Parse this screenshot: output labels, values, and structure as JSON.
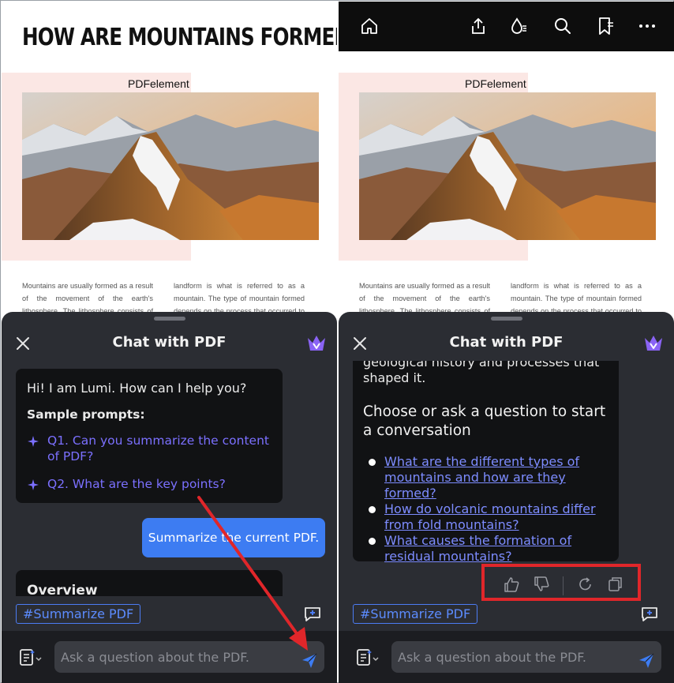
{
  "document": {
    "title": "HOW ARE MOUNTAINS FORMED?",
    "brand": "PDFelement",
    "col1_text": "Mountains are usually formed as a result of the movement of the earth's lithosphere. The lithosphere consists of the outer mantle",
    "col2_text": "landform is what is referred to as a mountain. The type of mountain formed depends on the process that occurred to form it."
  },
  "chat": {
    "title": "Chat with PDF",
    "greeting": "Hi! I am Lumi. How can I help you?",
    "sample_label": "Sample prompts:",
    "prompts": [
      "Q1. Can you summarize the content of PDF?",
      "Q2. What are the key points?"
    ],
    "user_message": "Summarize the current PDF.",
    "overview": "Overview",
    "answer_tail": "geological history and processes that shaped it.",
    "answer_heading": "Choose or ask a question to start a conversation",
    "suggestions": [
      "What are the different types of mountains and how are they formed?",
      "How do volcanic mountains differ from fold mountains?",
      "What causes the formation of residual mountains?"
    ],
    "tag": "#Summarize PDF",
    "input_placeholder": "Ask a question about the PDF."
  },
  "icons": {
    "toolbar": [
      "home-icon",
      "share-icon",
      "ink-icon",
      "search-icon",
      "bookmark-icon",
      "more-icon"
    ],
    "feedback": [
      "thumbs-up-icon",
      "thumbs-down-icon",
      "regenerate-icon",
      "copy-icon"
    ]
  },
  "colors": {
    "sheet_bg": "#2b2d33",
    "bubble_bg": "#111214",
    "accent_blue": "#3d7cf2",
    "link_purple": "#7b70ff",
    "annotation_red": "#e0262a"
  }
}
